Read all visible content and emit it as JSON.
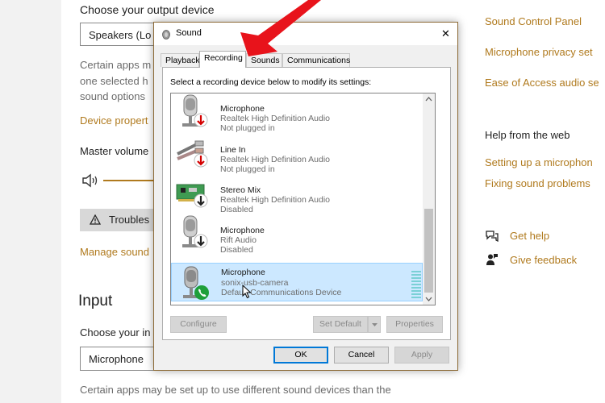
{
  "settings": {
    "output_heading": "Choose your output device",
    "output_combo": "Speakers (Lo",
    "output_desc": [
      "Certain apps m",
      "one selected h",
      "sound options"
    ],
    "device_props": "Device propert",
    "master_volume": "Master volume",
    "troubleshoot": "Troubles",
    "manage": "Manage sound",
    "input_heading": "Input",
    "input_choose": "Choose your in",
    "input_combo": "Microphone",
    "input_desc": [
      "Certain apps may be set up to use different sound devices than the"
    ],
    "right_links": [
      "Sound Control Panel",
      "Microphone privacy set",
      "Ease of Access audio se"
    ],
    "help_heading": "Help from the web",
    "help_links": [
      "Setting up a microphon",
      "Fixing sound problems"
    ],
    "get_help": "Get help",
    "give_feedback": "Give feedback"
  },
  "dialog": {
    "title": "Sound",
    "close": "✕",
    "tabs": [
      {
        "label": "Playback"
      },
      {
        "label": "Recording"
      },
      {
        "label": "Sounds"
      },
      {
        "label": "Communications"
      }
    ],
    "instruction": "Select a recording device below to modify its settings:",
    "devices": [
      {
        "name": "Microphone",
        "driver": "Realtek High Definition Audio",
        "status": "Not plugged in"
      },
      {
        "name": "Line In",
        "driver": "Realtek High Definition Audio",
        "status": "Not plugged in"
      },
      {
        "name": "Stereo Mix",
        "driver": "Realtek High Definition Audio",
        "status": "Disabled"
      },
      {
        "name": "Microphone",
        "driver": "Rift Audio",
        "status": "Disabled"
      },
      {
        "name": "Microphone",
        "driver": "sonix-usb-camera",
        "status": "Default Communications Device"
      }
    ],
    "buttons": {
      "configure": "Configure",
      "set_default": "Set Default",
      "properties": "Properties",
      "ok": "OK",
      "cancel": "Cancel",
      "apply": "Apply"
    }
  },
  "colors": {
    "accent": "#b07a1e",
    "arrow": "#e8131b",
    "selection": "#cce8ff",
    "ok_border": "#0078d7"
  }
}
